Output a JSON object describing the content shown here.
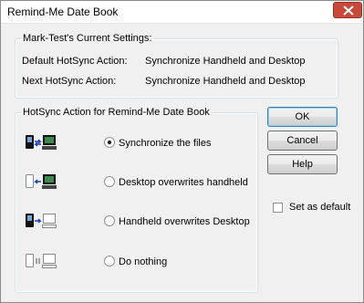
{
  "window": {
    "title": "Remind-Me Date Book"
  },
  "current_settings": {
    "legend": "Mark-Test's Current Settings:",
    "rows": [
      {
        "label": "Default HotSync Action:",
        "value": "Synchronize Handheld and Desktop"
      },
      {
        "label": "Next HotSync Action:",
        "value": "Synchronize Handheld and Desktop"
      }
    ]
  },
  "action_group": {
    "legend": "HotSync Action for Remind-Me Date Book",
    "options": [
      {
        "label": "Synchronize the files",
        "selected": true,
        "icon": "sync-both-icon"
      },
      {
        "label": "Desktop overwrites handheld",
        "selected": false,
        "icon": "desktop-to-handheld-icon"
      },
      {
        "label": "Handheld overwrites Desktop",
        "selected": false,
        "icon": "handheld-to-desktop-icon"
      },
      {
        "label": "Do nothing",
        "selected": false,
        "icon": "do-nothing-icon"
      }
    ]
  },
  "buttons": {
    "ok": "OK",
    "cancel": "Cancel",
    "help": "Help"
  },
  "set_default": {
    "label": "Set as default",
    "checked": false
  },
  "colors": {
    "close_button": "#c7493a",
    "accent": "#3c7fb1"
  }
}
